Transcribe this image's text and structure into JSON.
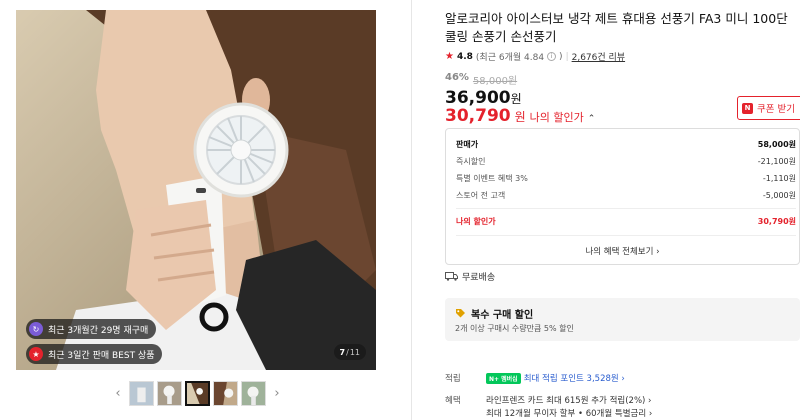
{
  "gallery": {
    "badges": [
      {
        "icon": "repurchase-icon",
        "text": "최근 3개월간 29명 재구매"
      },
      {
        "icon": "trophy-icon",
        "text": "최근 3일간 판매 BEST 상품"
      }
    ],
    "counter_current": "7",
    "counter_sep": "/",
    "counter_total": "11",
    "prev_arrow": "‹",
    "next_arrow": "›",
    "thumbnail_count": 5,
    "active_thumbnail": 3
  },
  "product": {
    "title": "알로코리아 아이스터보 냉각 제트 휴대용 선풍기 FA3 미니 100단 쿨링 손풍기 손선풍기",
    "rating": {
      "score": "4.8",
      "recent": "(최근 6개월 4.84",
      "reviews": "2,676건 리뷰"
    },
    "discount_rate": "46%",
    "original_price": "58,000원",
    "price": "36,900",
    "price_unit": "원",
    "my_price": "30,790",
    "my_price_unit": "원",
    "my_price_label": "나의 할인가",
    "coupon_label": "쿠폰 받기"
  },
  "breakdown": {
    "rows": [
      {
        "label": "판매가",
        "value": "58,000원"
      },
      {
        "label": "즉시할인",
        "value": "-21,100원"
      },
      {
        "label": "특별 이벤트 혜택 3%",
        "value": "-1,110원"
      },
      {
        "label": "스토어 전 고객",
        "value": "-5,000원"
      }
    ],
    "my_price_label": "나의 할인가",
    "my_price_value": "30,790원",
    "all_benefits": "나의 혜택 전체보기 ›"
  },
  "shipping": {
    "label": "무료배송"
  },
  "multi_buy": {
    "title": "복수 구매 할인",
    "desc": "2개 이상 구매시 수량만큼 5% 할인"
  },
  "points": {
    "label": "적립",
    "badge": "N+ 멤버십",
    "text": "최대 적립 포인트 3,528원 ›"
  },
  "benefits": {
    "label": "혜택",
    "line1": "라인프렌즈 카드 최대 615원 추가 적립(2%) ›",
    "line2": "최대 12개월 무이자 할부 • 60개월 특별금리 ›"
  },
  "colors": {
    "accent_red": "#e4222c",
    "link_blue": "#2b5ecf",
    "npay_green": "#03c75a"
  }
}
